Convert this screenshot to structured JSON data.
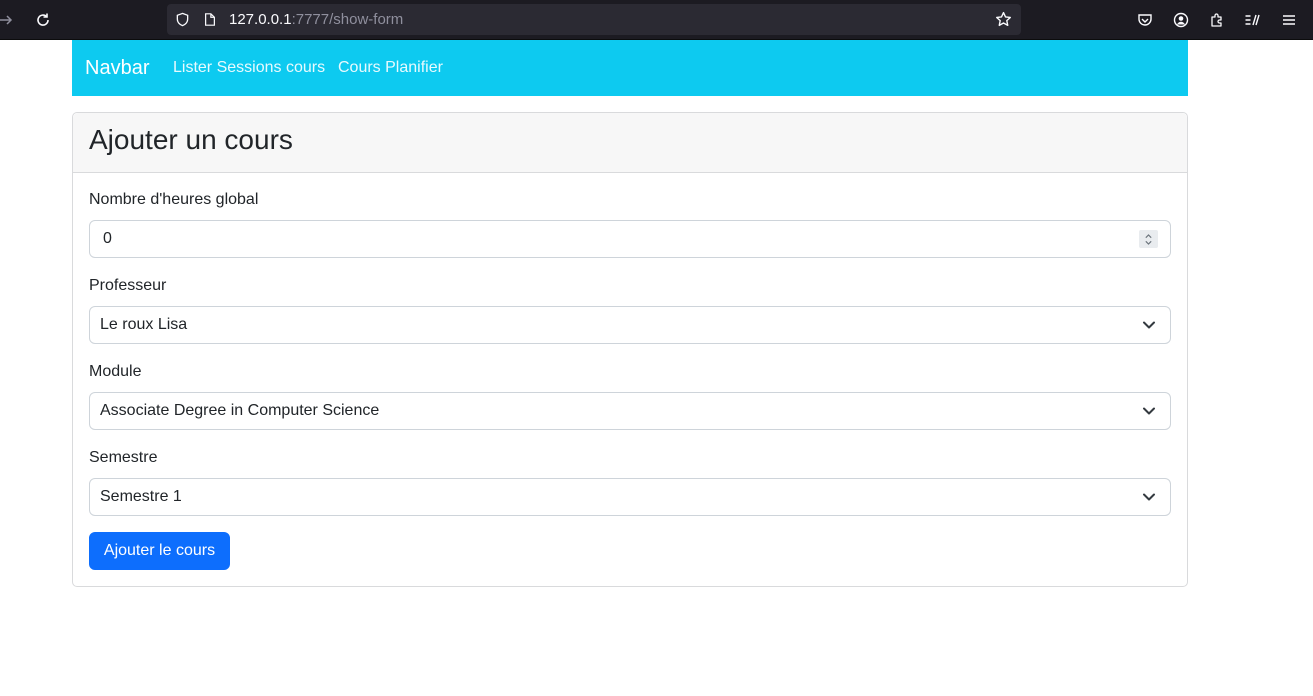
{
  "browser": {
    "url_host": "127.0.0.1",
    "url_path": ":7777/show-form"
  },
  "navbar": {
    "brand": "Navbar",
    "links": [
      "Lister Sessions cours",
      "Cours Planifier"
    ],
    "color": "#0dcaf0"
  },
  "form": {
    "title": "Ajouter un cours",
    "hours_label": "Nombre d'heures global",
    "hours_value": "0",
    "professor_label": "Professeur",
    "professor_value": "Le roux Lisa",
    "module_label": "Module",
    "module_value": "Associate Degree in Computer Science",
    "semester_label": "Semestre",
    "semester_value": "Semestre 1",
    "submit_label": "Ajouter le cours",
    "submit_color": "#0d6efd"
  },
  "icons": [
    "back-arrow-icon",
    "reload-icon",
    "shield-icon",
    "page-icon",
    "star-icon",
    "pocket-icon",
    "account-icon",
    "extensions-icon",
    "reader-view-icon",
    "menu-icon",
    "spinner-icon",
    "chevron-down-icon"
  ]
}
